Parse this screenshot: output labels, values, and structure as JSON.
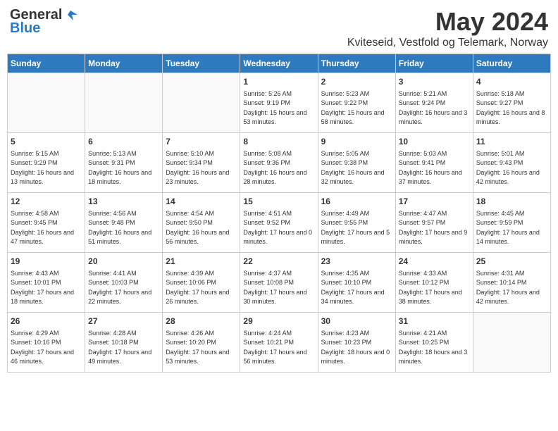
{
  "header": {
    "logo_general": "General",
    "logo_blue": "Blue",
    "month_year": "May 2024",
    "location": "Kviteseid, Vestfold og Telemark, Norway"
  },
  "weekdays": [
    "Sunday",
    "Monday",
    "Tuesday",
    "Wednesday",
    "Thursday",
    "Friday",
    "Saturday"
  ],
  "weeks": [
    [
      {
        "day": "",
        "info": ""
      },
      {
        "day": "",
        "info": ""
      },
      {
        "day": "",
        "info": ""
      },
      {
        "day": "1",
        "info": "Sunrise: 5:26 AM\nSunset: 9:19 PM\nDaylight: 15 hours and 53 minutes."
      },
      {
        "day": "2",
        "info": "Sunrise: 5:23 AM\nSunset: 9:22 PM\nDaylight: 15 hours and 58 minutes."
      },
      {
        "day": "3",
        "info": "Sunrise: 5:21 AM\nSunset: 9:24 PM\nDaylight: 16 hours and 3 minutes."
      },
      {
        "day": "4",
        "info": "Sunrise: 5:18 AM\nSunset: 9:27 PM\nDaylight: 16 hours and 8 minutes."
      }
    ],
    [
      {
        "day": "5",
        "info": "Sunrise: 5:15 AM\nSunset: 9:29 PM\nDaylight: 16 hours and 13 minutes."
      },
      {
        "day": "6",
        "info": "Sunrise: 5:13 AM\nSunset: 9:31 PM\nDaylight: 16 hours and 18 minutes."
      },
      {
        "day": "7",
        "info": "Sunrise: 5:10 AM\nSunset: 9:34 PM\nDaylight: 16 hours and 23 minutes."
      },
      {
        "day": "8",
        "info": "Sunrise: 5:08 AM\nSunset: 9:36 PM\nDaylight: 16 hours and 28 minutes."
      },
      {
        "day": "9",
        "info": "Sunrise: 5:05 AM\nSunset: 9:38 PM\nDaylight: 16 hours and 32 minutes."
      },
      {
        "day": "10",
        "info": "Sunrise: 5:03 AM\nSunset: 9:41 PM\nDaylight: 16 hours and 37 minutes."
      },
      {
        "day": "11",
        "info": "Sunrise: 5:01 AM\nSunset: 9:43 PM\nDaylight: 16 hours and 42 minutes."
      }
    ],
    [
      {
        "day": "12",
        "info": "Sunrise: 4:58 AM\nSunset: 9:45 PM\nDaylight: 16 hours and 47 minutes."
      },
      {
        "day": "13",
        "info": "Sunrise: 4:56 AM\nSunset: 9:48 PM\nDaylight: 16 hours and 51 minutes."
      },
      {
        "day": "14",
        "info": "Sunrise: 4:54 AM\nSunset: 9:50 PM\nDaylight: 16 hours and 56 minutes."
      },
      {
        "day": "15",
        "info": "Sunrise: 4:51 AM\nSunset: 9:52 PM\nDaylight: 17 hours and 0 minutes."
      },
      {
        "day": "16",
        "info": "Sunrise: 4:49 AM\nSunset: 9:55 PM\nDaylight: 17 hours and 5 minutes."
      },
      {
        "day": "17",
        "info": "Sunrise: 4:47 AM\nSunset: 9:57 PM\nDaylight: 17 hours and 9 minutes."
      },
      {
        "day": "18",
        "info": "Sunrise: 4:45 AM\nSunset: 9:59 PM\nDaylight: 17 hours and 14 minutes."
      }
    ],
    [
      {
        "day": "19",
        "info": "Sunrise: 4:43 AM\nSunset: 10:01 PM\nDaylight: 17 hours and 18 minutes."
      },
      {
        "day": "20",
        "info": "Sunrise: 4:41 AM\nSunset: 10:03 PM\nDaylight: 17 hours and 22 minutes."
      },
      {
        "day": "21",
        "info": "Sunrise: 4:39 AM\nSunset: 10:06 PM\nDaylight: 17 hours and 26 minutes."
      },
      {
        "day": "22",
        "info": "Sunrise: 4:37 AM\nSunset: 10:08 PM\nDaylight: 17 hours and 30 minutes."
      },
      {
        "day": "23",
        "info": "Sunrise: 4:35 AM\nSunset: 10:10 PM\nDaylight: 17 hours and 34 minutes."
      },
      {
        "day": "24",
        "info": "Sunrise: 4:33 AM\nSunset: 10:12 PM\nDaylight: 17 hours and 38 minutes."
      },
      {
        "day": "25",
        "info": "Sunrise: 4:31 AM\nSunset: 10:14 PM\nDaylight: 17 hours and 42 minutes."
      }
    ],
    [
      {
        "day": "26",
        "info": "Sunrise: 4:29 AM\nSunset: 10:16 PM\nDaylight: 17 hours and 46 minutes."
      },
      {
        "day": "27",
        "info": "Sunrise: 4:28 AM\nSunset: 10:18 PM\nDaylight: 17 hours and 49 minutes."
      },
      {
        "day": "28",
        "info": "Sunrise: 4:26 AM\nSunset: 10:20 PM\nDaylight: 17 hours and 53 minutes."
      },
      {
        "day": "29",
        "info": "Sunrise: 4:24 AM\nSunset: 10:21 PM\nDaylight: 17 hours and 56 minutes."
      },
      {
        "day": "30",
        "info": "Sunrise: 4:23 AM\nSunset: 10:23 PM\nDaylight: 18 hours and 0 minutes."
      },
      {
        "day": "31",
        "info": "Sunrise: 4:21 AM\nSunset: 10:25 PM\nDaylight: 18 hours and 3 minutes."
      },
      {
        "day": "",
        "info": ""
      }
    ]
  ]
}
